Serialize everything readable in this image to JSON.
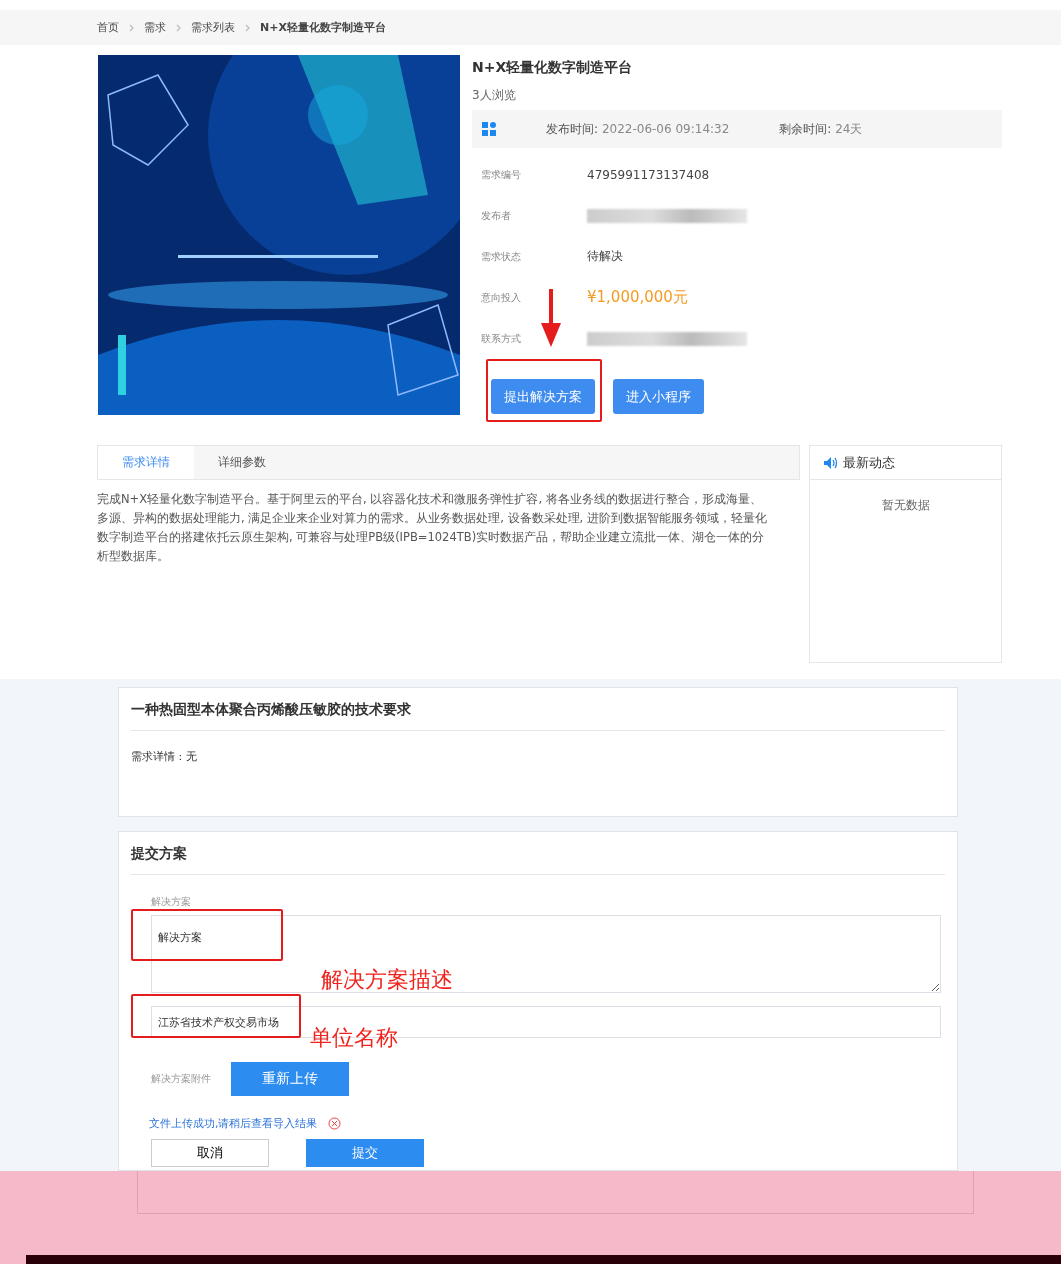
{
  "breadcrumb": [
    {
      "label": "首页",
      "current": false
    },
    {
      "label": "需求",
      "current": false
    },
    {
      "label": "需求列表",
      "current": false
    },
    {
      "label": "N+X轻量化数字制造平台",
      "current": true
    }
  ],
  "demand": {
    "title": "N+X轻量化数字制造平台",
    "views": "3人浏览",
    "publish_label": "发布时间:",
    "publish_time": "2022-06-06 09:14:32",
    "remaining_label": "剩余时间:",
    "remaining": "24天",
    "fields": [
      {
        "label": "需求编号",
        "value": "4795991173137408",
        "kind": "text"
      },
      {
        "label": "发布者",
        "kind": "redacted"
      },
      {
        "label": "需求状态",
        "value": "待解决",
        "kind": "text"
      },
      {
        "label": "意向投入",
        "value": "¥1,000,000元",
        "kind": "price"
      },
      {
        "label": "联系方式",
        "kind": "redacted"
      }
    ],
    "buttons": [
      {
        "label": "提出解决方案",
        "highlighted": true
      },
      {
        "label": "进入小程序",
        "highlighted": false
      }
    ]
  },
  "tabs": [
    {
      "label": "需求详情",
      "selected": true
    },
    {
      "label": "详细参数",
      "selected": false
    }
  ],
  "description": "完成N+X轻量化数字制造平台。基于阿里云的平台, 以容器化技术和微服务弹性扩容, 将各业务线的数据进行整合，形成海量、多源、异构的数据处理能力, 满足企业来企业对算力的需求。从业务数据处理, 设备数采处理, 进阶到数据智能服务领域，轻量化数字制造平台的搭建依托云原生架构, 可兼容与处理PB级(IPB=1024TB)实时数据产品，帮助企业建立流批一体、湖仓一体的分析型数据库。",
  "news": {
    "title": "最新动态",
    "empty": "暂无数据"
  },
  "requirement": {
    "title": "一种热固型本体聚合丙烯酸压敏胶的技术要求",
    "detail": "需求详情 : 无"
  },
  "submit": {
    "title": "提交方案",
    "solution_label": "解决方案",
    "solution_value": "解决方案",
    "solution_note": "解决方案描述",
    "company_value": "江苏省技术产权交易市场",
    "company_note": "单位名称",
    "attachment_label": "解决方案附件",
    "upload_button": "重新上传",
    "upload_message": "文件上传成功,请稍后查看导入结果",
    "cancel": "取消",
    "submit": "提交"
  }
}
